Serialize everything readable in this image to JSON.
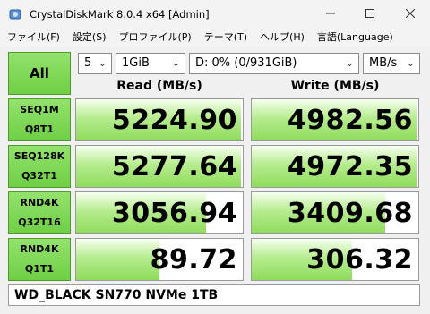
{
  "window": {
    "title": "CrystalDiskMark 8.0.4 x64 [Admin]"
  },
  "menu": [
    "ファイル(F)",
    "設定(S)",
    "プロファイル(P)",
    "テーマ(T)",
    "ヘルプ(H)",
    "言語(Language)"
  ],
  "controls": {
    "all_label": "All",
    "count": "5",
    "size": "1GiB",
    "drive": "D: 0% (0/931GiB)",
    "unit": "MB/s"
  },
  "headers": {
    "read": "Read (MB/s)",
    "write": "Write (MB/s)"
  },
  "rows": [
    {
      "line1": "SEQ1M",
      "line2": "Q8T1",
      "read": "5224.90",
      "write": "4982.56",
      "read_fill": 0.99,
      "write_fill": 0.99
    },
    {
      "line1": "SEQ128K",
      "line2": "Q32T1",
      "read": "5277.64",
      "write": "4972.35",
      "read_fill": 0.99,
      "write_fill": 0.99
    },
    {
      "line1": "RND4K",
      "line2": "Q32T16",
      "read": "3056.94",
      "write": "3409.68",
      "read_fill": 0.78,
      "write_fill": 0.8
    },
    {
      "line1": "RND4K",
      "line2": "Q1T1",
      "read": "89.72",
      "write": "306.32",
      "read_fill": 0.5,
      "write_fill": 0.6
    }
  ],
  "drive_name": "WD_BLACK SN770 NVMe 1TB"
}
